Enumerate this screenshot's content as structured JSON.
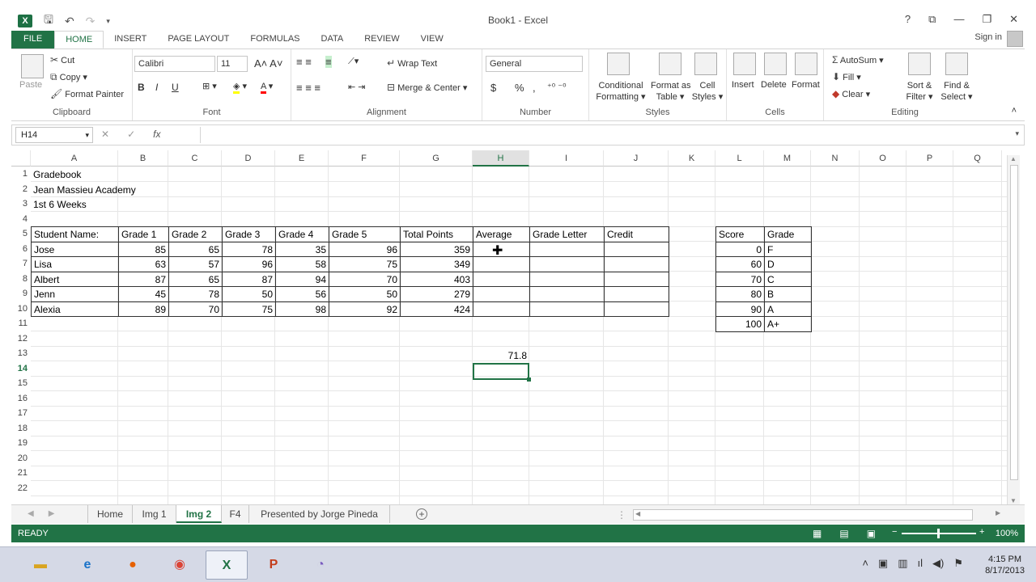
{
  "window": {
    "title": "Book1 - Excel",
    "controls": [
      "?",
      "⧉",
      "—",
      "❐",
      "✕"
    ]
  },
  "ribbon_tabs": [
    "FILE",
    "HOME",
    "INSERT",
    "PAGE LAYOUT",
    "FORMULAS",
    "DATA",
    "REVIEW",
    "VIEW"
  ],
  "active_ribbon_tab": "HOME",
  "signin": "Sign in",
  "ribbon": {
    "clipboard": {
      "label": "Clipboard",
      "paste": "Paste",
      "cut": "Cut",
      "copy": "Copy",
      "format_painter": "Format Painter"
    },
    "font": {
      "label": "Font",
      "font_name": "Calibri",
      "font_size": "11",
      "bold": "B",
      "italic": "I",
      "underline": "U"
    },
    "alignment": {
      "label": "Alignment",
      "wrap_text": "Wrap Text",
      "merge_center": "Merge & Center"
    },
    "number": {
      "label": "Number",
      "format": "General",
      "currency": "$",
      "percent": "%",
      "comma": ","
    },
    "styles": {
      "label": "Styles",
      "conditional": "Conditional",
      "conditional2": "Formatting",
      "format_as": "Format as",
      "format_as2": "Table",
      "cell_styles": "Cell",
      "cell_styles2": "Styles"
    },
    "cells": {
      "label": "Cells",
      "insert": "Insert",
      "delete": "Delete",
      "format": "Format"
    },
    "editing": {
      "label": "Editing",
      "autosum": "AutoSum",
      "fill": "Fill",
      "clear": "Clear",
      "sort_filter": "Sort &",
      "sort_filter2": "Filter",
      "find_select": "Find &",
      "find_select2": "Select"
    }
  },
  "formula_bar": {
    "name_box": "H14",
    "fx": "fx",
    "value": ""
  },
  "columns": [
    "A",
    "B",
    "C",
    "D",
    "E",
    "F",
    "G",
    "H",
    "I",
    "J",
    "K",
    "L",
    "M",
    "N",
    "O",
    "P",
    "Q"
  ],
  "selected_column": "H",
  "rows": [
    "1",
    "2",
    "3",
    "4",
    "5",
    "6",
    "7",
    "8",
    "9",
    "10",
    "11",
    "12",
    "13",
    "14",
    "15",
    "16",
    "17",
    "18",
    "19",
    "20",
    "21",
    "22"
  ],
  "selected_row": "14",
  "sheet": {
    "title1": "Gradebook",
    "title2": "Jean Massieu Academy",
    "title3": "1st 6 Weeks",
    "headers": [
      "Student Name:",
      "Grade 1",
      "Grade 2",
      "Grade 3",
      "Grade 4",
      "Grade 5",
      "Total Points",
      "Average",
      "Grade Letter",
      "Credit"
    ],
    "students": [
      {
        "name": "Jose",
        "g1": "85",
        "g2": "65",
        "g3": "78",
        "g4": "35",
        "g5": "96",
        "total": "359"
      },
      {
        "name": "Lisa",
        "g1": "63",
        "g2": "57",
        "g3": "96",
        "g4": "58",
        "g5": "75",
        "total": "349"
      },
      {
        "name": "Albert",
        "g1": "87",
        "g2": "65",
        "g3": "87",
        "g4": "94",
        "g5": "70",
        "total": "403"
      },
      {
        "name": "Jenn",
        "g1": "45",
        "g2": "78",
        "g3": "50",
        "g4": "56",
        "g5": "50",
        "total": "279"
      },
      {
        "name": "Alexia",
        "g1": "89",
        "g2": "70",
        "g3": "75",
        "g4": "98",
        "g5": "92",
        "total": "424"
      }
    ],
    "h13_value": "71.8",
    "lookup_headers": [
      "Score",
      "Grade"
    ],
    "lookup": [
      {
        "score": "0",
        "grade": "F"
      },
      {
        "score": "60",
        "grade": "D"
      },
      {
        "score": "70",
        "grade": "C"
      },
      {
        "score": "80",
        "grade": "B"
      },
      {
        "score": "90",
        "grade": "A"
      },
      {
        "score": "100",
        "grade": "A+"
      }
    ]
  },
  "sheet_tabs": [
    "Home",
    "Img 1",
    "Img 2",
    "F4",
    "Presented by Jorge Pineda"
  ],
  "active_sheet": "Img 2",
  "status": {
    "text": "READY",
    "zoom": "100%"
  },
  "taskbar": {
    "apps": [
      "file-explorer-icon",
      "internet-explorer-icon",
      "firefox-icon",
      "chrome-icon",
      "excel-icon",
      "powerpoint-icon",
      "speedometer-icon"
    ],
    "time": "4:15 PM",
    "date": "8/17/2013"
  },
  "colors": {
    "excel_green": "#217346",
    "taskbar": "#d5d9e6"
  }
}
